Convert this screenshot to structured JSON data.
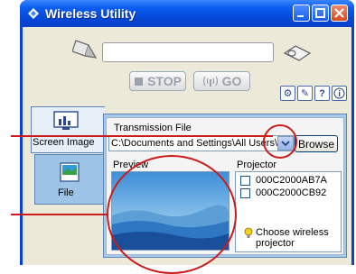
{
  "window": {
    "title": "Wireless Utility"
  },
  "toolbar": {
    "stop_label": "STOP",
    "go_label": "GO"
  },
  "tabs": [
    {
      "label": "Screen Image"
    },
    {
      "label": "File"
    }
  ],
  "file_panel": {
    "transmission_label": "Transmission File",
    "path_value": "C:\\Documents and Settings\\All Users\\",
    "browse_label": "Browse",
    "preview_label": "Preview",
    "projector_label": "Projector"
  },
  "projectors": [
    {
      "name": "000C2000AB7A"
    },
    {
      "name": "000C2000CB92"
    }
  ],
  "hint": {
    "line1": "Choose wireless",
    "line2": "projector"
  },
  "colors": {
    "annotation": "#cc1b1b",
    "titlebar": "#0a5cf0",
    "tab_active": "#9dc3e6"
  }
}
